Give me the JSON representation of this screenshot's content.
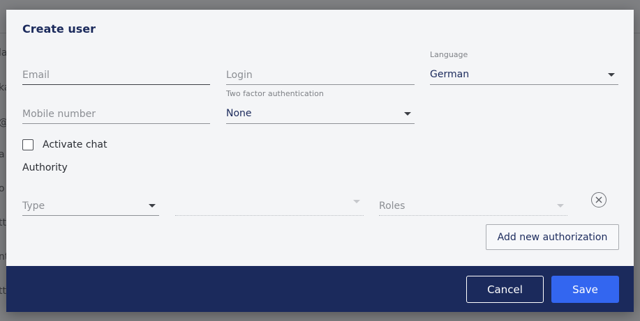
{
  "dialog": {
    "title": "Create user"
  },
  "fields": {
    "email": {
      "placeholder": "Email"
    },
    "login": {
      "placeholder": "Login"
    },
    "language": {
      "label": "Language",
      "value": "German"
    },
    "mobile": {
      "placeholder": "Mobile number"
    },
    "two_factor": {
      "label": "Two factor authentication",
      "value": "None"
    }
  },
  "chat": {
    "label": "Activate chat",
    "checked": false
  },
  "authority": {
    "section_label": "Authority",
    "type_placeholder": "Type",
    "roles_placeholder": "Roles",
    "add_button": "Add new authorization",
    "remove_icon": "close-circle-icon"
  },
  "footer": {
    "cancel": "Cancel",
    "save": "Save"
  },
  "colors": {
    "primary": "#1b2a5c",
    "accent": "#3366f0",
    "dialog_bg": "#f4f5f7",
    "overlay": "#7f8083"
  },
  "backdrop_fragments": [
    "la",
    "ka",
    "@",
    "a",
    "o",
    "tt",
    "nt",
    "tt"
  ]
}
